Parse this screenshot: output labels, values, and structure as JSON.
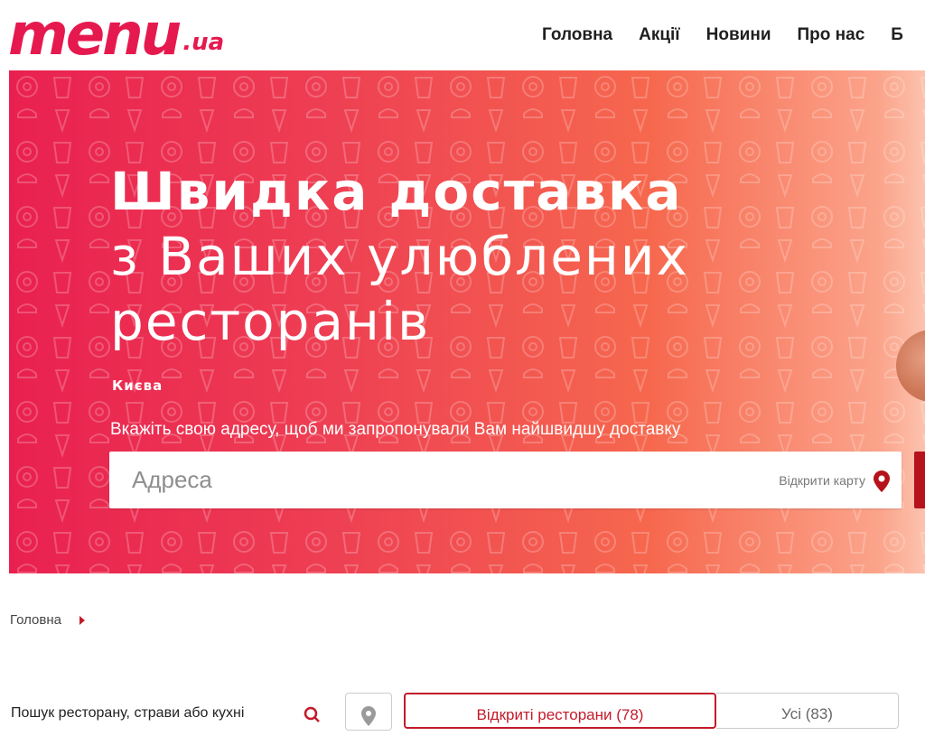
{
  "header": {
    "logo_main": "menu",
    "logo_suffix": ".ua",
    "nav": [
      "Головна",
      "Акції",
      "Новини",
      "Про нас",
      "Б"
    ]
  },
  "hero": {
    "title_line1": "Швидка доставка",
    "title_line2": "з Ваших улюблених",
    "title_line3": "ресторанів",
    "city": "Києва",
    "hint": "Вкажіть свою адресу, щоб ми запропонували Вам найшвидшу доставку",
    "address_placeholder": "Адреса",
    "open_map": "Відкрити карту"
  },
  "breadcrumb": {
    "home": "Головна"
  },
  "filters": {
    "search_label": "Пошук ресторану, страви або кухні",
    "tab_open": "Відкриті ресторани (78)",
    "tab_all": "Усі (83)"
  },
  "colors": {
    "brand": "#e6194f",
    "accent_dark": "#c31a2a",
    "gradient_start": "#e9204f",
    "gradient_end": "#fcc2ae"
  },
  "icons": [
    "map-pin-icon",
    "search-icon",
    "location-icon",
    "chevron-right-icon"
  ]
}
